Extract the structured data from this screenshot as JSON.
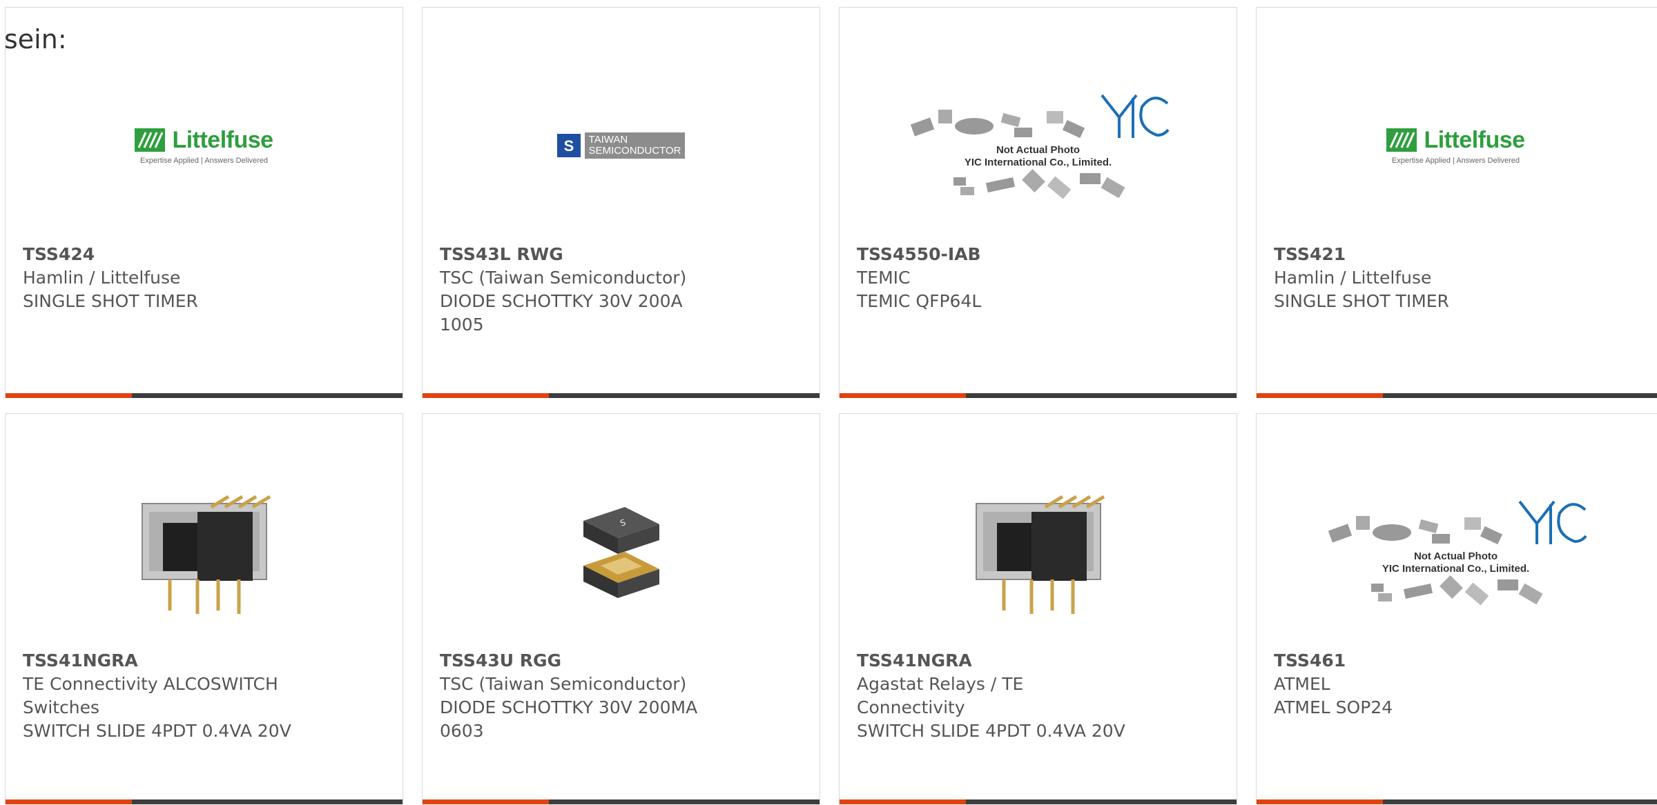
{
  "lead_text": "sein:",
  "logos": {
    "littelfuse_word": "Littelfuse",
    "littelfuse_tagline": "Expertise Applied | Answers Delivered",
    "tsc_line1": "TAIWAN",
    "tsc_line2": "SEMICONDUCTOR",
    "yic_caption1": "Not Actual Photo",
    "yic_caption2": "YIC International Co., Limited."
  },
  "colors": {
    "accent": "#e0430f",
    "bar": "#3d3d3d",
    "littelfuse_green": "#2e9e3e",
    "yic_blue": "#1a6fb5"
  },
  "products": [
    {
      "pn": "TSS424",
      "mfr": "Hamlin / Littelfuse",
      "desc": "SINGLE SHOT TIMER",
      "image": "littelfuse-logo"
    },
    {
      "pn": "TSS43L RWG",
      "mfr": "TSC (Taiwan Semiconductor)",
      "desc": "DIODE SCHOTTKY 30V 200A 1005",
      "image": "tsc-logo"
    },
    {
      "pn": "TSS4550-IAB",
      "mfr": "TEMIC",
      "desc": "TEMIC QFP64L",
      "image": "yic-placeholder"
    },
    {
      "pn": "TSS421",
      "mfr": "Hamlin / Littelfuse",
      "desc": "SINGLE SHOT TIMER",
      "image": "littelfuse-logo"
    },
    {
      "pn": "TSS41NGRA",
      "mfr": "TE Connectivity ALCOSWITCH Switches",
      "desc": "SWITCH SLIDE 4PDT 0.4VA 20V",
      "image": "slide-switch"
    },
    {
      "pn": "TSS43U RGG",
      "mfr": "TSC (Taiwan Semiconductor)",
      "desc": "DIODE SCHOTTKY 30V 200MA 0603",
      "image": "smd-diode"
    },
    {
      "pn": "TSS41NGRA",
      "mfr": "Agastat Relays / TE Connectivity",
      "desc": "SWITCH SLIDE 4PDT 0.4VA 20V",
      "image": "slide-switch"
    },
    {
      "pn": "TSS461",
      "mfr": "ATMEL",
      "desc": "ATMEL SOP24",
      "image": "yic-placeholder"
    }
  ]
}
